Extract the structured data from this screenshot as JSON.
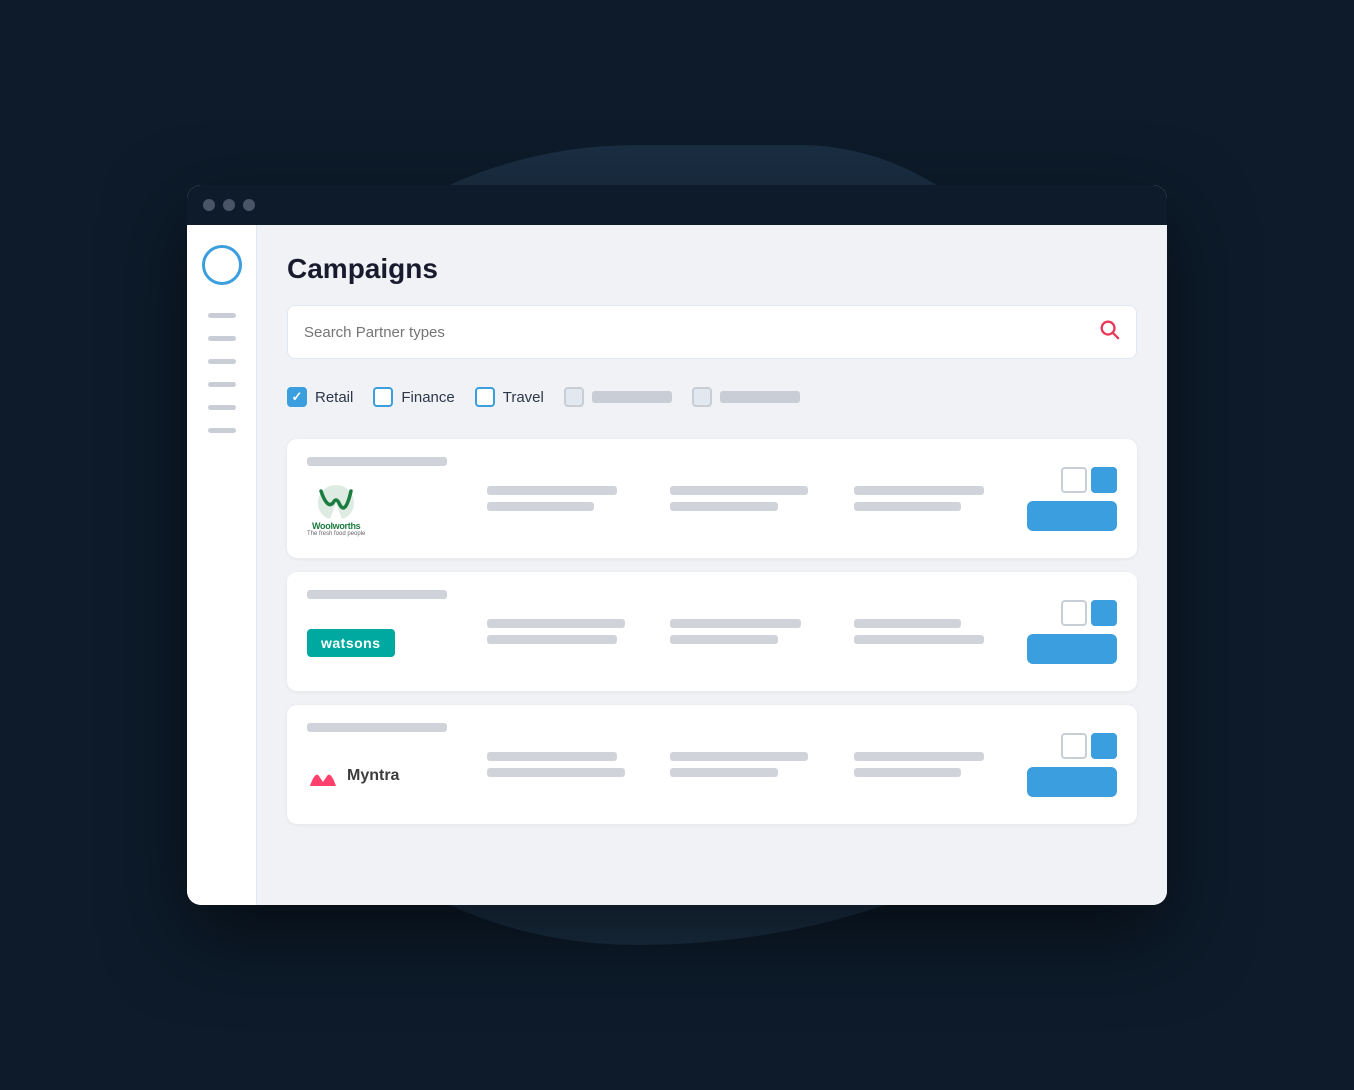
{
  "background": {
    "blob_color": "#1a2e42"
  },
  "browser": {
    "titlebar_color": "#0d1b2a",
    "traffic_dots": [
      "#4a5568",
      "#4a5568",
      "#4a5568"
    ]
  },
  "sidebar": {
    "logo_border_color": "#3b9ede",
    "icon_bars": 6
  },
  "page": {
    "title": "Campaigns",
    "search_placeholder": "Search Partner types"
  },
  "filters": [
    {
      "label": "Retail",
      "checked": true
    },
    {
      "label": "Finance",
      "checked": false
    },
    {
      "label": "Travel",
      "checked": false
    },
    {
      "label": "",
      "checked": false,
      "placeholder": true
    },
    {
      "label": "",
      "checked": false,
      "placeholder": true
    }
  ],
  "campaigns": [
    {
      "id": "woolworths",
      "name": "Woolworths",
      "action_button_label": ""
    },
    {
      "id": "watsons",
      "name": "Watsons",
      "action_button_label": ""
    },
    {
      "id": "myntra",
      "name": "Myntra",
      "action_button_label": ""
    }
  ],
  "icons": {
    "search": "🔍",
    "check": "✓"
  }
}
